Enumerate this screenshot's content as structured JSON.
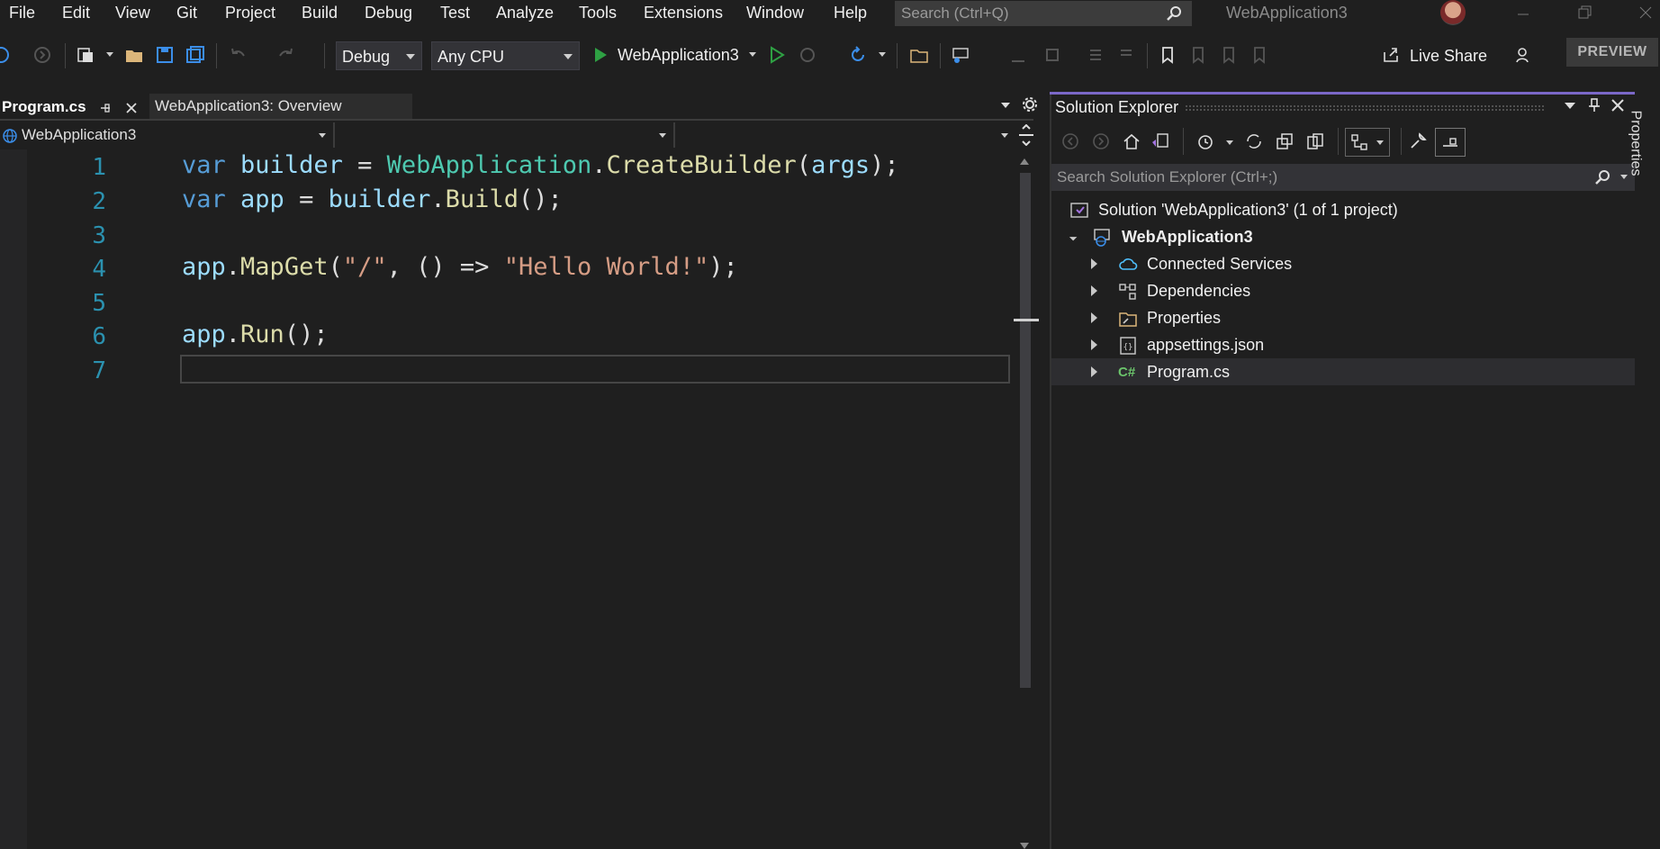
{
  "menu": {
    "items": [
      "File",
      "Edit",
      "View",
      "Git",
      "Project",
      "Build",
      "Debug",
      "Test",
      "Analyze",
      "Tools",
      "Extensions",
      "Window",
      "Help"
    ],
    "search_placeholder": "Search (Ctrl+Q)",
    "app_title": "WebApplication3"
  },
  "toolbar": {
    "config": "Debug",
    "platform": "Any CPU",
    "run_target": "WebApplication3",
    "live_share": "Live Share",
    "preview": "PREVIEW"
  },
  "editor": {
    "tabs": [
      {
        "label": "Program.cs",
        "active": true
      },
      {
        "label": "WebApplication3: Overview",
        "active": false
      }
    ],
    "nav_project": "WebApplication3",
    "line_numbers": [
      "1",
      "2",
      "3",
      "4",
      "5",
      "6",
      "7"
    ],
    "code": {
      "l1": {
        "kw": "var",
        "id1": "builder",
        "op": " = ",
        "ty": "WebApplication",
        "dot": ".",
        "fn": "CreateBuilder",
        "p1": "(",
        "id2": "args",
        "p2": ");"
      },
      "l2": {
        "kw": "var",
        "id1": "app",
        "op": " = ",
        "id2": "builder",
        "dot": ".",
        "fn": "Build",
        "p": "();"
      },
      "l4": {
        "id": "app",
        "dot": ".",
        "fn": "MapGet",
        "p1": "(",
        "s1": "\"/\"",
        "mid": ", () => ",
        "s2": "\"Hello World!\"",
        "p2": ");"
      },
      "l6": {
        "id": "app",
        "dot": ".",
        "fn": "Run",
        "p": "();"
      }
    }
  },
  "solution_explorer": {
    "title": "Solution Explorer",
    "search_placeholder": "Search Solution Explorer (Ctrl+;)",
    "solution": "Solution 'WebApplication3' (1 of 1 project)",
    "project": "WebApplication3",
    "items": [
      "Connected Services",
      "Dependencies",
      "Properties",
      "appsettings.json",
      "Program.cs"
    ],
    "csharp_glyph": "C#"
  },
  "side_tab": "Properties",
  "colors": {
    "accent": "#7b68c8",
    "line_number": "#2b91af",
    "keyword": "#569cd6",
    "type": "#4ec9b0",
    "method": "#dcdcaa",
    "string": "#d69d85",
    "identifier": "#9cdcfe"
  }
}
